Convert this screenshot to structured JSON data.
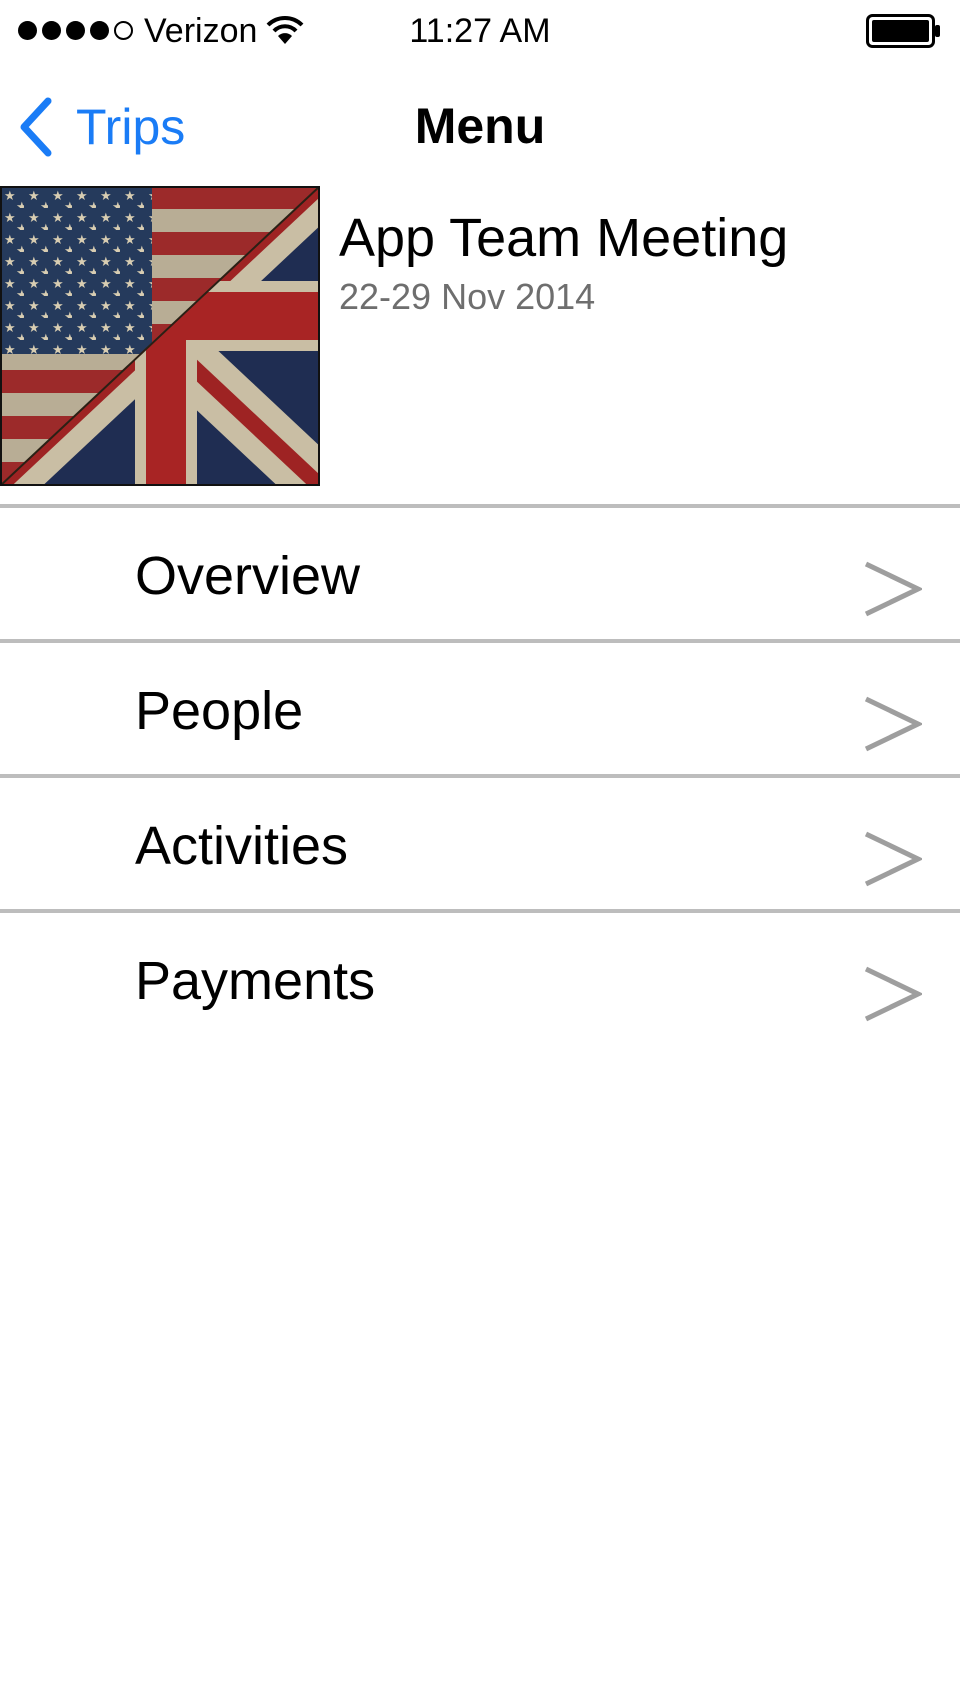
{
  "status_bar": {
    "carrier": "Verizon",
    "time": "11:27 AM",
    "signal_bars_filled": 4,
    "signal_bars_total": 5,
    "battery_level": 1.0
  },
  "nav": {
    "back_label": "Trips",
    "title": "Menu"
  },
  "trip": {
    "title": "App Team Meeting",
    "dates": "22-29 Nov 2014",
    "image_icon": "us-uk-flag-image"
  },
  "menu": {
    "items": [
      {
        "label": "Overview"
      },
      {
        "label": "People"
      },
      {
        "label": "Activities"
      },
      {
        "label": "Payments"
      }
    ],
    "chevron_icon": "chevron-right-icon"
  },
  "colors": {
    "accent": "#1a7cf6",
    "divider": "#bdbdbd",
    "secondary_text": "#6e6e6e",
    "chevron": "#9e9e9e"
  }
}
